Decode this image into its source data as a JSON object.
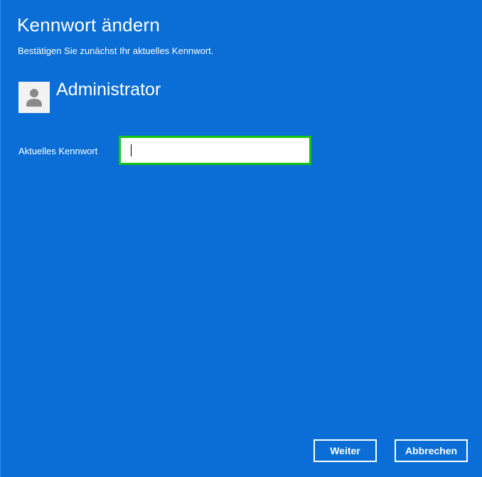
{
  "dialog": {
    "title": "Kennwort ändern",
    "subtitle": "Bestätigen Sie zunächst Ihr aktuelles Kennwort."
  },
  "user": {
    "name": "Administrator",
    "avatar_icon": "user-avatar-icon"
  },
  "password_field": {
    "label": "Aktuelles Kennwort",
    "value": "",
    "placeholder": ""
  },
  "buttons": {
    "next_label": "Weiter",
    "cancel_label": "Abbrechen"
  },
  "colors": {
    "background": "#0a6ed6",
    "focus_border": "#16c60c",
    "text": "#ffffff"
  }
}
